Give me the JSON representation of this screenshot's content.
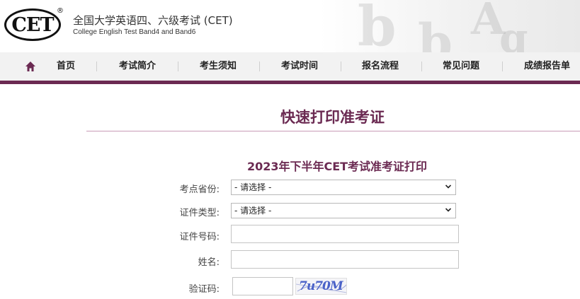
{
  "header": {
    "logo_text": "CET",
    "registered_mark": "®",
    "title_cn": "全国大学英语四、六级考试 (CET)",
    "title_en": "College English Test Band4 and Band6"
  },
  "nav": {
    "home_icon": "home-icon",
    "items": [
      "首页",
      "考试简介",
      "考生须知",
      "考试时间",
      "报名流程",
      "常见问题",
      "成绩报告单"
    ]
  },
  "page": {
    "title": "快速打印准考证",
    "form_title": "2023年下半年CET考试准考证打印"
  },
  "form": {
    "province_label": "考点省份:",
    "province_value": "- 请选择 -",
    "id_type_label": "证件类型:",
    "id_type_value": "- 请选择 -",
    "id_number_label": "证件号码:",
    "id_number_value": "",
    "name_label": "姓名:",
    "name_value": "",
    "captcha_label": "验证码:",
    "captcha_value": "",
    "captcha_image_text": "7u70M"
  },
  "colors": {
    "accent": "#6b2a52",
    "nav_bg": "#f2f2f2"
  }
}
